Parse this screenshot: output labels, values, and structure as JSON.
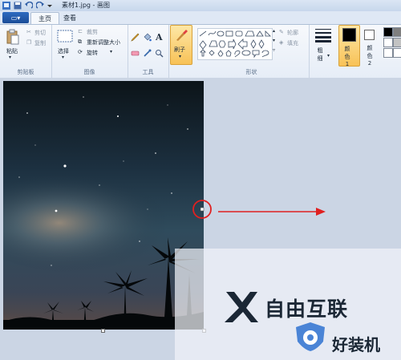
{
  "window": {
    "title": "素材1.jpg - 画图"
  },
  "tabs": {
    "file_label": "",
    "home": "主页",
    "view": "查看"
  },
  "clipboard": {
    "paste": "粘贴",
    "cut": "剪切",
    "copy": "复制",
    "group": "剪贴板"
  },
  "image_group": {
    "select": "选择",
    "crop": "裁剪",
    "resize": "重新调整大小",
    "rotate": "旋转",
    "group": "图像"
  },
  "tools_group": {
    "group": "工具"
  },
  "brush": {
    "label": "刷子"
  },
  "shapes": {
    "outline": "轮廓",
    "fill": "填充",
    "group": "形状"
  },
  "size": {
    "label": "粗细"
  },
  "color1": {
    "label": "颜色 1",
    "value": "#000000"
  },
  "color2": {
    "label": "颜色 2",
    "value": "#ffffff"
  },
  "watermark": {
    "brand1": "自由互联",
    "brand2": "好装机"
  },
  "accent_color": "#e02020"
}
